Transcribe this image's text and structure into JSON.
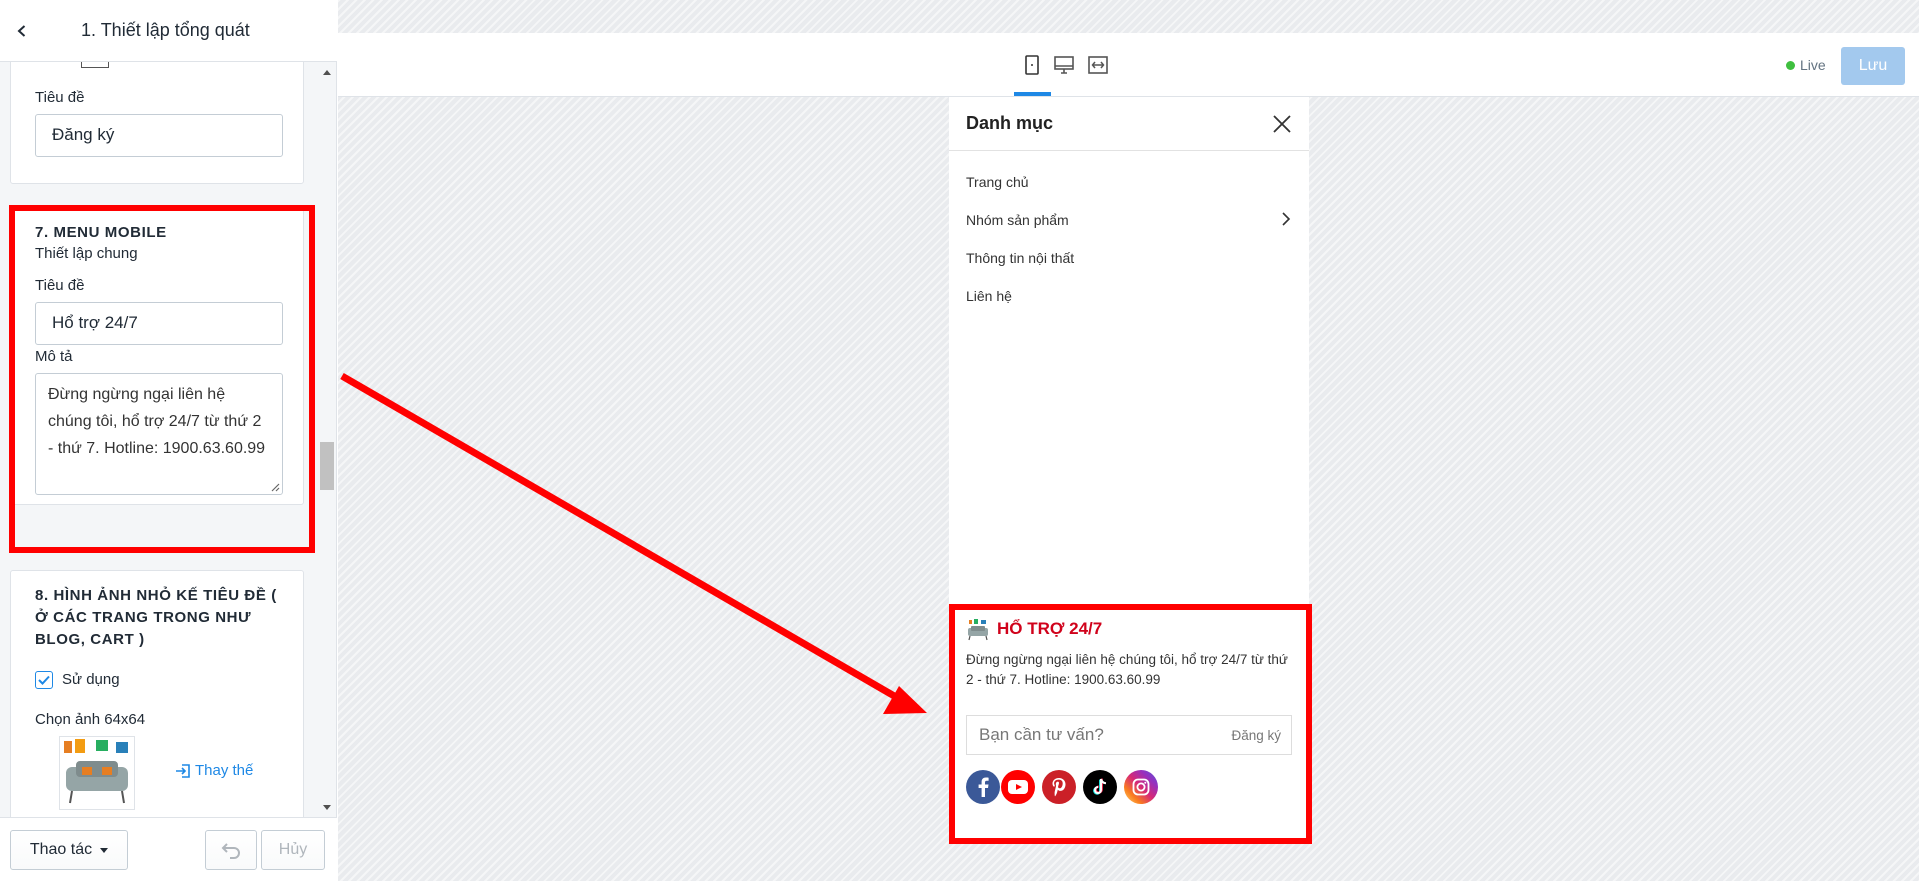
{
  "sidebar": {
    "header_title": "1. Thiết lập tổng quát",
    "card1": {
      "label": "Tiêu đề",
      "value": "Đăng ký"
    },
    "menu_mobile": {
      "heading": "7. MENU MOBILE",
      "subheading": "Thiết lập chung",
      "title_label": "Tiêu đề",
      "title_value": "Hổ trợ 24/7",
      "desc_label": "Mô tả",
      "desc_value": "Đừng ngừng ngại liên hệ chúng tôi, hổ trợ 24/7 từ thứ 2 - thứ 7. Hotline: 1900.63.60.99"
    },
    "thumb_section": {
      "heading": "8. HÌNH ẢNH NHỎ KẾ TIÊU ĐỀ ( Ở CÁC TRANG TRONG NHƯ BLOG, CART )",
      "checkbox_label": "Sử dụng",
      "checked": true,
      "image_label": "Chọn ảnh 64x64",
      "replace_label": "Thay thế"
    },
    "footer": {
      "actions_label": "Thao tác",
      "cancel_label": "Hủy"
    }
  },
  "topbar": {
    "live_label": "Live",
    "save_label": "Lưu",
    "devices": [
      "mobile-icon",
      "desktop-icon",
      "fullwidth-icon"
    ],
    "active_device": "mobile"
  },
  "preview": {
    "menu_title": "Danh mục",
    "menu_items": [
      "Trang chủ",
      "Nhóm sản phẩm",
      "Thông tin nội thất",
      "Liên hệ"
    ],
    "support_title": "HỔ TRỢ 24/7",
    "support_desc": "Đừng ngừng ngại liên hệ chúng tôi, hổ trợ 24/7 từ thứ 2 - thứ 7. Hotline: 1900.63.60.99",
    "newsletter_placeholder": "Bạn cần tư vấn?",
    "newsletter_button": "Đăng ký",
    "socials": [
      "facebook-icon",
      "youtube-icon",
      "pinterest-icon",
      "tiktok-icon",
      "instagram-icon"
    ]
  },
  "colors": {
    "highlight": "#ff0000",
    "accent": "#1e88e5",
    "support_title": "#d0021b",
    "save_button": "#a3c9ee",
    "live_dot": "#3fbf3f"
  }
}
